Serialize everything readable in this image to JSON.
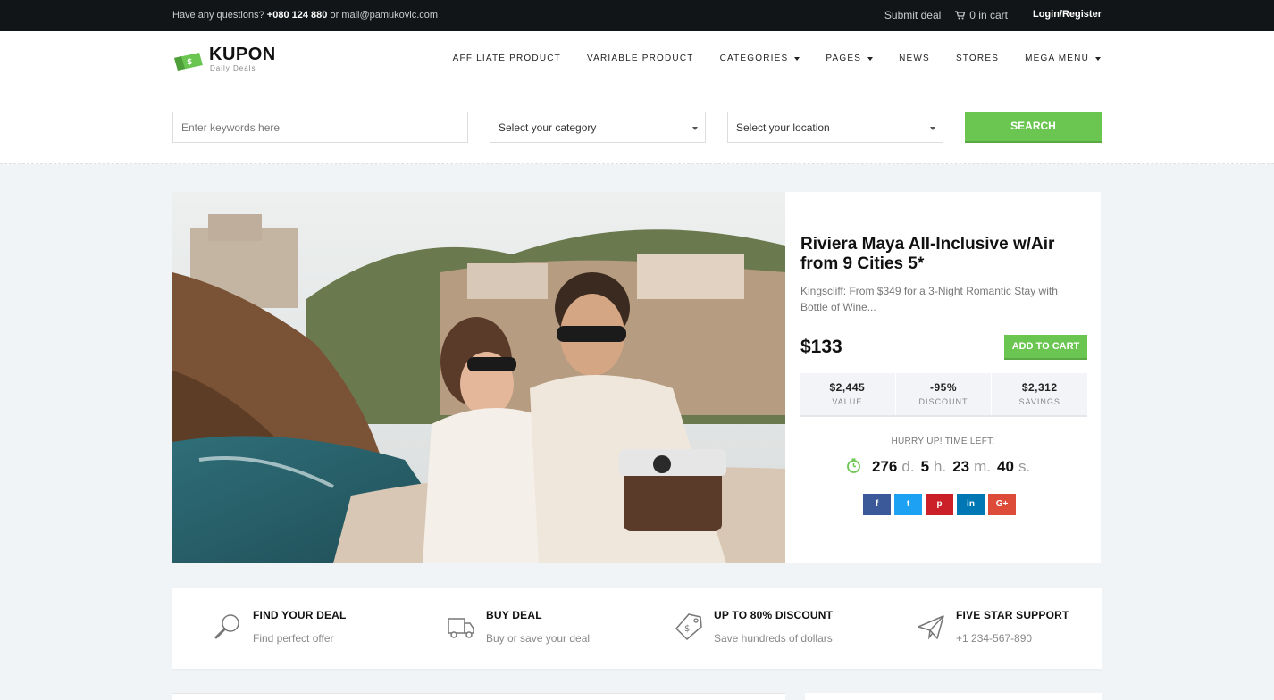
{
  "topbar": {
    "question": "Have any questions?",
    "phone": "+080 124 880",
    "or": "or",
    "email": "mail@pamukovic.com",
    "submit_deal": "Submit deal",
    "cart": "0 in cart",
    "login": "Login/Register"
  },
  "logo": {
    "title": "KUPON",
    "subtitle": "Daily Deals"
  },
  "nav": {
    "items": [
      "AFFILIATE PRODUCT",
      "VARIABLE PRODUCT",
      "CATEGORIES",
      "PAGES",
      "NEWS",
      "STORES",
      "MEGA MENU"
    ]
  },
  "search": {
    "keyword_placeholder": "Enter keywords here",
    "category": "Select your category",
    "location": "Select your location",
    "button": "SEARCH"
  },
  "deal": {
    "title": "Riviera Maya All-Inclusive w/Air from 9 Cities 5*",
    "description": "Kingscliff: From $349 for a 3-Night Romantic Stay with Bottle of Wine...",
    "price": "$133",
    "add_to_cart": "ADD TO CART",
    "stats": [
      {
        "value": "$2,445",
        "label": "VALUE"
      },
      {
        "value": "-95%",
        "label": "DISCOUNT"
      },
      {
        "value": "$2,312",
        "label": "SAVINGS"
      }
    ],
    "hurry": "HURRY UP! TIME LEFT:",
    "timer": {
      "days": "276",
      "d": "d.",
      "hours": "5",
      "h": "h.",
      "minutes": "23",
      "m": "m.",
      "seconds": "40",
      "s": "s."
    },
    "social": [
      {
        "name": "facebook",
        "glyph": "f",
        "color": "#3b5998"
      },
      {
        "name": "twitter",
        "glyph": "t",
        "color": "#1da1f2"
      },
      {
        "name": "pinterest",
        "glyph": "p",
        "color": "#cb2027"
      },
      {
        "name": "linkedin",
        "glyph": "in",
        "color": "#0077b5"
      },
      {
        "name": "google-plus",
        "glyph": "G+",
        "color": "#dd4b39"
      }
    ]
  },
  "features": [
    {
      "icon": "magnifier-icon",
      "title": "FIND YOUR DEAL",
      "subtitle": "Find perfect offer"
    },
    {
      "icon": "truck-icon",
      "title": "BUY DEAL",
      "subtitle": "Buy or save your deal"
    },
    {
      "icon": "tag-icon",
      "title": "UP TO 80% DISCOUNT",
      "subtitle": "Save hundreds of dollars"
    },
    {
      "icon": "paper-plane-icon",
      "title": "FIVE STAR SUPPORT",
      "subtitle": "+1 234-567-890"
    }
  ],
  "colors": {
    "accent": "#6bc651",
    "topbar": "#121517",
    "background": "#f1f4f7"
  }
}
